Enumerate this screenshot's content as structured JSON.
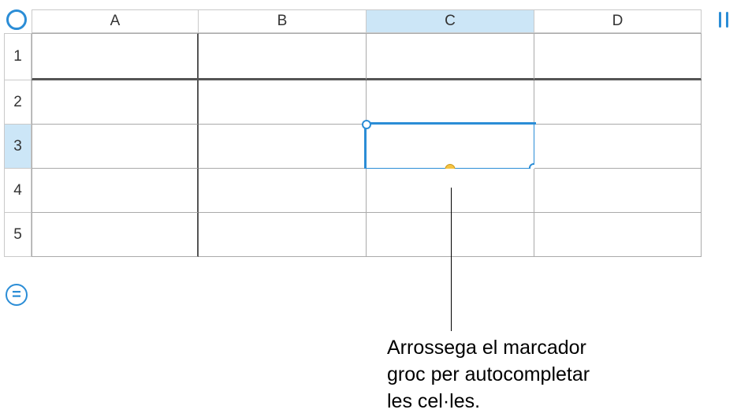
{
  "columns": {
    "a": "A",
    "b": "B",
    "c": "C",
    "d": "D"
  },
  "rows": {
    "r1": "1",
    "r2": "2",
    "r3": "3",
    "r4": "4",
    "r5": "5"
  },
  "selected": {
    "col": "C",
    "row": "3"
  },
  "equals_label": "=",
  "callout": {
    "line1": "Arrossega el marcador",
    "line2": "groc per autocompletar",
    "line3": "les cel·les."
  }
}
